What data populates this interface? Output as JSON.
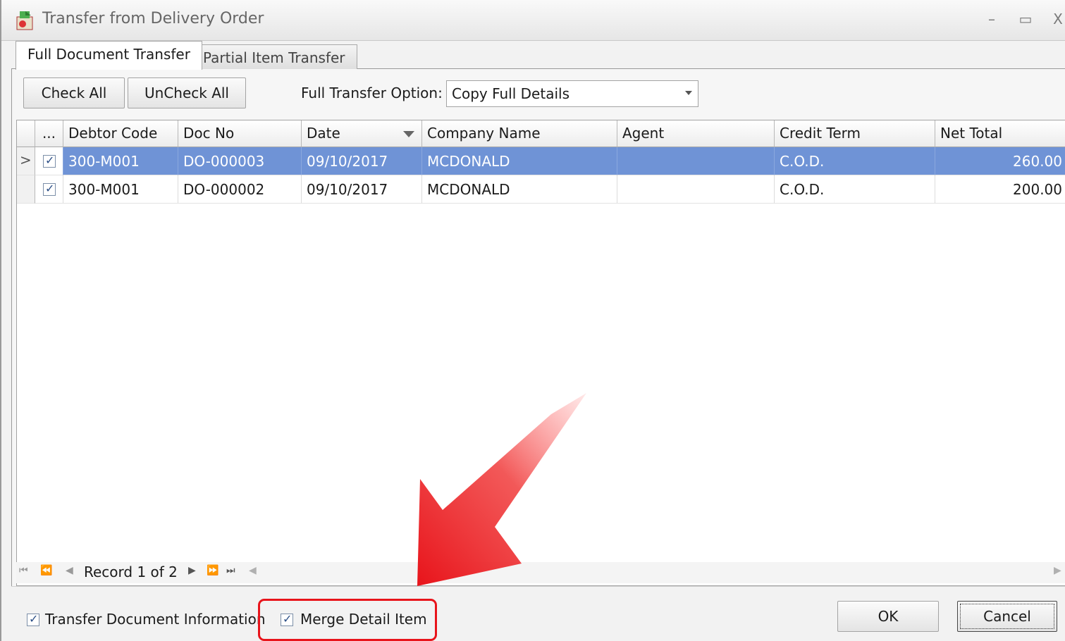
{
  "window": {
    "title": "Transfer from Delivery Order",
    "minimize": "–",
    "maximize": "▭",
    "close": "X"
  },
  "tabs": [
    {
      "label": "Full Document Transfer",
      "active": true
    },
    {
      "label": "Partial Item Transfer",
      "active": false
    }
  ],
  "toolbar": {
    "check_all": "Check All",
    "uncheck_all": "UnCheck All",
    "option_label": "Full Transfer Option:",
    "option_value": "Copy Full Details"
  },
  "grid": {
    "columns": [
      "...",
      "Debtor Code",
      "Doc No",
      "Date",
      "Company Name",
      "Agent",
      "Credit Term",
      "Net Total"
    ],
    "rows": [
      {
        "selected": true,
        "checked": true,
        "debtor_code": "300-M001",
        "doc_no": "DO-000003",
        "date": "09/10/2017",
        "company": "MCDONALD",
        "agent": "",
        "credit_term": "C.O.D.",
        "net_total": "260.00"
      },
      {
        "selected": false,
        "checked": true,
        "debtor_code": "300-M001",
        "doc_no": "DO-000002",
        "date": "09/10/2017",
        "company": "MCDONALD",
        "agent": "",
        "credit_term": "C.O.D.",
        "net_total": "200.00"
      }
    ],
    "row_indicator": ">"
  },
  "navigator": {
    "record_text": "Record 1 of 2"
  },
  "footer": {
    "transfer_info_label": "Transfer Document Information",
    "transfer_info_checked": true,
    "merge_label": "Merge Detail Item",
    "merge_checked": true,
    "ok": "OK",
    "cancel": "Cancel"
  },
  "colors": {
    "selection": "#6f93d6",
    "highlight": "#e8141b"
  }
}
